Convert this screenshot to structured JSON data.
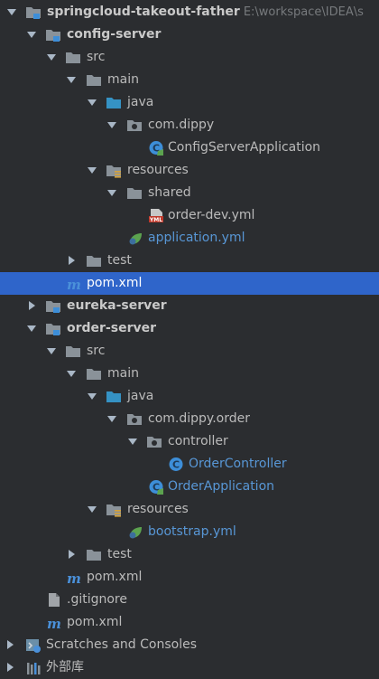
{
  "tree": {
    "root": {
      "name": "springcloud-takeout-father",
      "path": "E:\\workspace\\IDEA\\s"
    },
    "config_server": {
      "name": "config-server",
      "src": "src",
      "main": "main",
      "java": "java",
      "package": "com.dippy",
      "app_class": "ConfigServerApplication",
      "resources": "resources",
      "shared": "shared",
      "order_dev": "order-dev.yml",
      "application_yml": "application.yml",
      "test": "test",
      "pom": "pom.xml"
    },
    "eureka_server": {
      "name": "eureka-server"
    },
    "order_server": {
      "name": "order-server",
      "src": "src",
      "main": "main",
      "java": "java",
      "package": "com.dippy.order",
      "controller": "controller",
      "controller_class": "OrderController",
      "app_class": "OrderApplication",
      "resources": "resources",
      "bootstrap_yml": "bootstrap.yml",
      "test": "test",
      "pom": "pom.xml"
    },
    "gitignore": ".gitignore",
    "root_pom": "pom.xml",
    "scratches": "Scratches and Consoles",
    "external_libs": "外部库"
  },
  "icons": {
    "module_folder": "module-folder-icon",
    "folder": "folder-icon",
    "source_folder": "source-folder-icon",
    "package": "package-icon",
    "spring_class": "spring-boot-class-icon",
    "class": "class-icon",
    "resources_folder": "resources-folder-icon",
    "yml_file": "yml-file-icon",
    "spring_config": "spring-config-file-icon",
    "maven_file": "maven-pom-icon",
    "text_file": "text-file-icon",
    "scratches": "scratches-icon",
    "libraries": "libraries-icon"
  },
  "colors": {
    "background": "#2b2d30",
    "selection": "#2f65ca",
    "text": "#bbbbbb",
    "modified_blue": "#5897d6"
  },
  "selected_item": "pom.xml"
}
